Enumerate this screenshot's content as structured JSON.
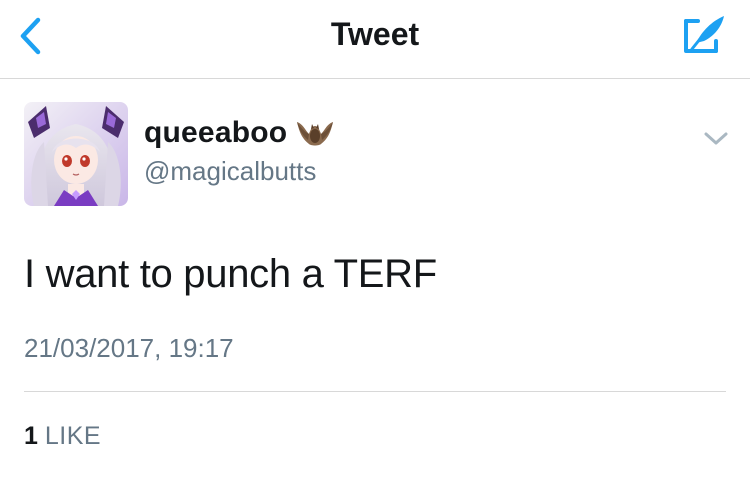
{
  "nav": {
    "title": "Tweet",
    "back_icon": "chevron-left-icon",
    "compose_icon": "compose-quill-icon"
  },
  "tweet": {
    "display_name": "queeaboo",
    "emoji": "bat-emoji",
    "handle": "@magicalbutts",
    "text": "I want to punch a TERF",
    "timestamp": "21/03/2017, 19:17",
    "likes": {
      "count": "1",
      "label": "LIKE"
    }
  },
  "colors": {
    "accent": "#1da1f2",
    "text_primary": "#14171a",
    "text_secondary": "#657786",
    "divider": "#d8d8d8",
    "chevron": "#aab8c2"
  }
}
